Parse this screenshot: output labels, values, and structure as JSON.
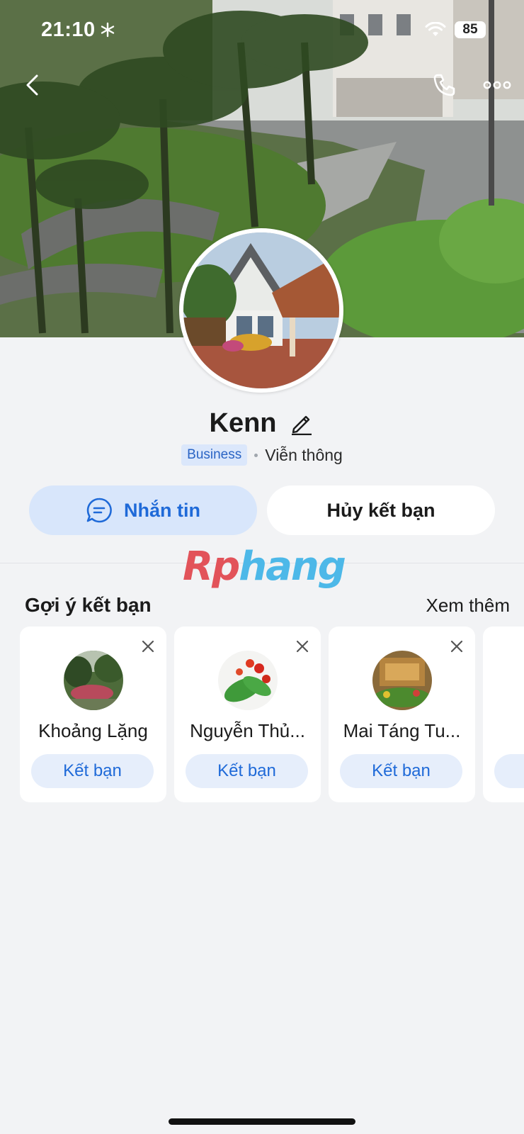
{
  "status_bar": {
    "time": "21:10",
    "battery": "85",
    "icons": [
      "snowflake-icon",
      "wifi-icon",
      "battery-icon"
    ]
  },
  "nav": {
    "icons": [
      "back-arrow-icon",
      "phone-icon",
      "more-dots-icon"
    ]
  },
  "profile": {
    "name": "Kenn",
    "badge": "Business",
    "category": "Viễn thông"
  },
  "actions": {
    "message_label": "Nhắn tin",
    "unfriend_label": "Hủy kết bạn"
  },
  "watermark": {
    "part1": "Rp",
    "part2": "hang"
  },
  "suggestions": {
    "title": "Gợi ý kết bạn",
    "see_more": "Xem thêm",
    "items": [
      {
        "name": "Khoảng Lặng",
        "button": "Kết bạn"
      },
      {
        "name": "Nguyễn Thủ...",
        "button": "Kết bạn"
      },
      {
        "name": "Mai Táng Tu...",
        "button": "Kết bạn"
      }
    ]
  },
  "colors": {
    "accent": "#1f6ad8",
    "accent_bg": "#d8e6fb",
    "background": "#f2f3f5"
  }
}
